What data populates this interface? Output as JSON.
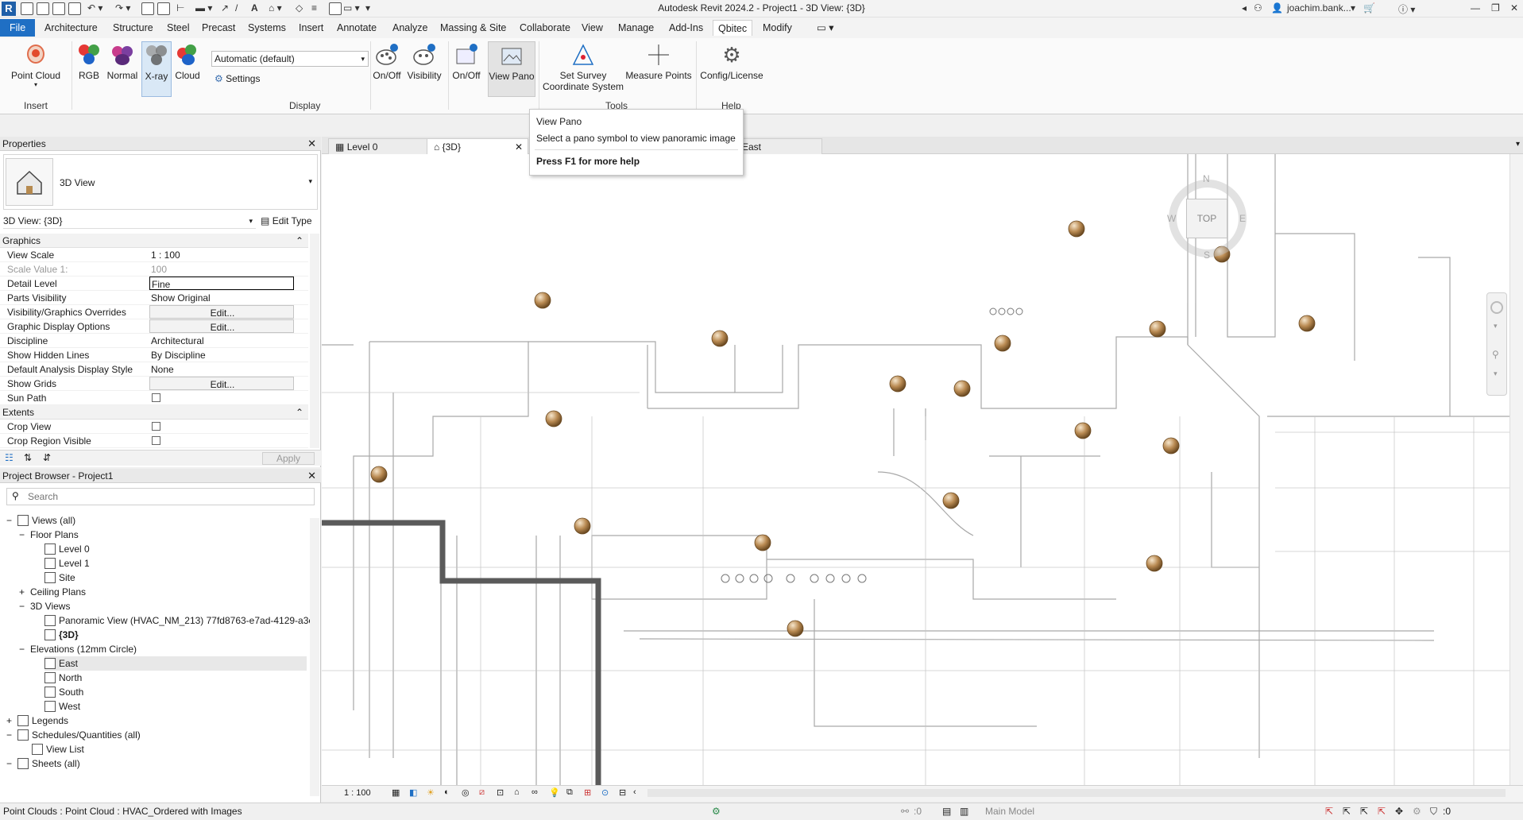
{
  "window": {
    "title": "Autodesk Revit 2024.2 - Project1 - 3D View: {3D}",
    "user": "joachim.bank...",
    "logo": "R"
  },
  "menu_tabs": [
    "File",
    "Architecture",
    "Structure",
    "Steel",
    "Precast",
    "Systems",
    "Insert",
    "Annotate",
    "Analyze",
    "Massing & Site",
    "Collaborate",
    "View",
    "Manage",
    "Add-Ins",
    "Qbitec",
    "Modify"
  ],
  "active_tab": "Qbitec",
  "ribbon": {
    "point_cloud": "Point Cloud",
    "rgb": "RGB",
    "normal": "Normal",
    "xray": "X-ray",
    "cloud": "Cloud",
    "display_dropdown": "Automatic (default)",
    "settings": "Settings",
    "onoff1": "On/Off",
    "visibility": "Visibility",
    "onoff2": "On/Off",
    "view_pano": "View Pano",
    "set_survey": "Set Survey",
    "coordinate_system": "Coordinate System",
    "measure_points": "Measure Points",
    "config_license": "Config/License",
    "panels": {
      "insert": "Insert",
      "display": "Display",
      "tools": "Tools",
      "help": "Help"
    }
  },
  "tooltip": {
    "title": "View Pano",
    "description": "Select a pano symbol to view panoramic image",
    "help": "Press F1 for more help"
  },
  "properties": {
    "header": "Properties",
    "type_name": "3D View",
    "selector": "3D View: {3D}",
    "edit_type": "Edit Type",
    "groups": {
      "graphics": "Graphics",
      "extents": "Extents"
    },
    "rows": [
      {
        "key": "View Scale",
        "value": "1 : 100"
      },
      {
        "key": "Scale Value    1:",
        "value": "100"
      },
      {
        "key": "Detail Level",
        "value": "Fine"
      },
      {
        "key": "Parts Visibility",
        "value": "Show Original"
      },
      {
        "key": "Visibility/Graphics Overrides",
        "value": "Edit..."
      },
      {
        "key": "Graphic Display Options",
        "value": "Edit..."
      },
      {
        "key": "Discipline",
        "value": "Architectural"
      },
      {
        "key": "Show Hidden Lines",
        "value": "By Discipline"
      },
      {
        "key": "Default Analysis Display Style",
        "value": "None"
      },
      {
        "key": "Show Grids",
        "value": "Edit..."
      },
      {
        "key": "Sun Path",
        "value": ""
      }
    ],
    "extents_rows": [
      {
        "key": "Crop View",
        "value": ""
      },
      {
        "key": "Crop Region Visible",
        "value": ""
      }
    ],
    "apply": "Apply"
  },
  "browser": {
    "header": "Project Browser - Project1",
    "search_placeholder": "Search",
    "nodes": [
      {
        "label": "Views (all)"
      },
      {
        "label": "Floor Plans"
      },
      {
        "label": "Level 0"
      },
      {
        "label": "Level 1"
      },
      {
        "label": "Site"
      },
      {
        "label": "Ceiling Plans"
      },
      {
        "label": "3D Views"
      },
      {
        "label": "Panoramic View (HVAC_NM_213) 77fd8763-e7ad-4129-a3c"
      },
      {
        "label": "{3D}"
      },
      {
        "label": "Elevations (12mm Circle)"
      },
      {
        "label": "East"
      },
      {
        "label": "North"
      },
      {
        "label": "South"
      },
      {
        "label": "West"
      },
      {
        "label": "Legends"
      },
      {
        "label": "Schedules/Quantities (all)"
      },
      {
        "label": "View List"
      },
      {
        "label": "Sheets (all)"
      }
    ]
  },
  "view_tabs": [
    {
      "label": "Level 0"
    },
    {
      "label": "{3D}"
    },
    {
      "label": "East"
    }
  ],
  "viewcube": {
    "top": "TOP",
    "n": "N",
    "s": "S",
    "e": "E",
    "w": "W"
  },
  "view_control": {
    "scale": "1 : 100"
  },
  "status": {
    "text": "Point Clouds : Point Cloud : HVAC_Ordered with Images",
    "coord": ":0",
    "model": "Main Model",
    "filter": ":0"
  },
  "colors": {
    "file_tab": "#1f6fc4",
    "pano_sphere": "#b98a52",
    "wall": "#5a5a5a"
  }
}
